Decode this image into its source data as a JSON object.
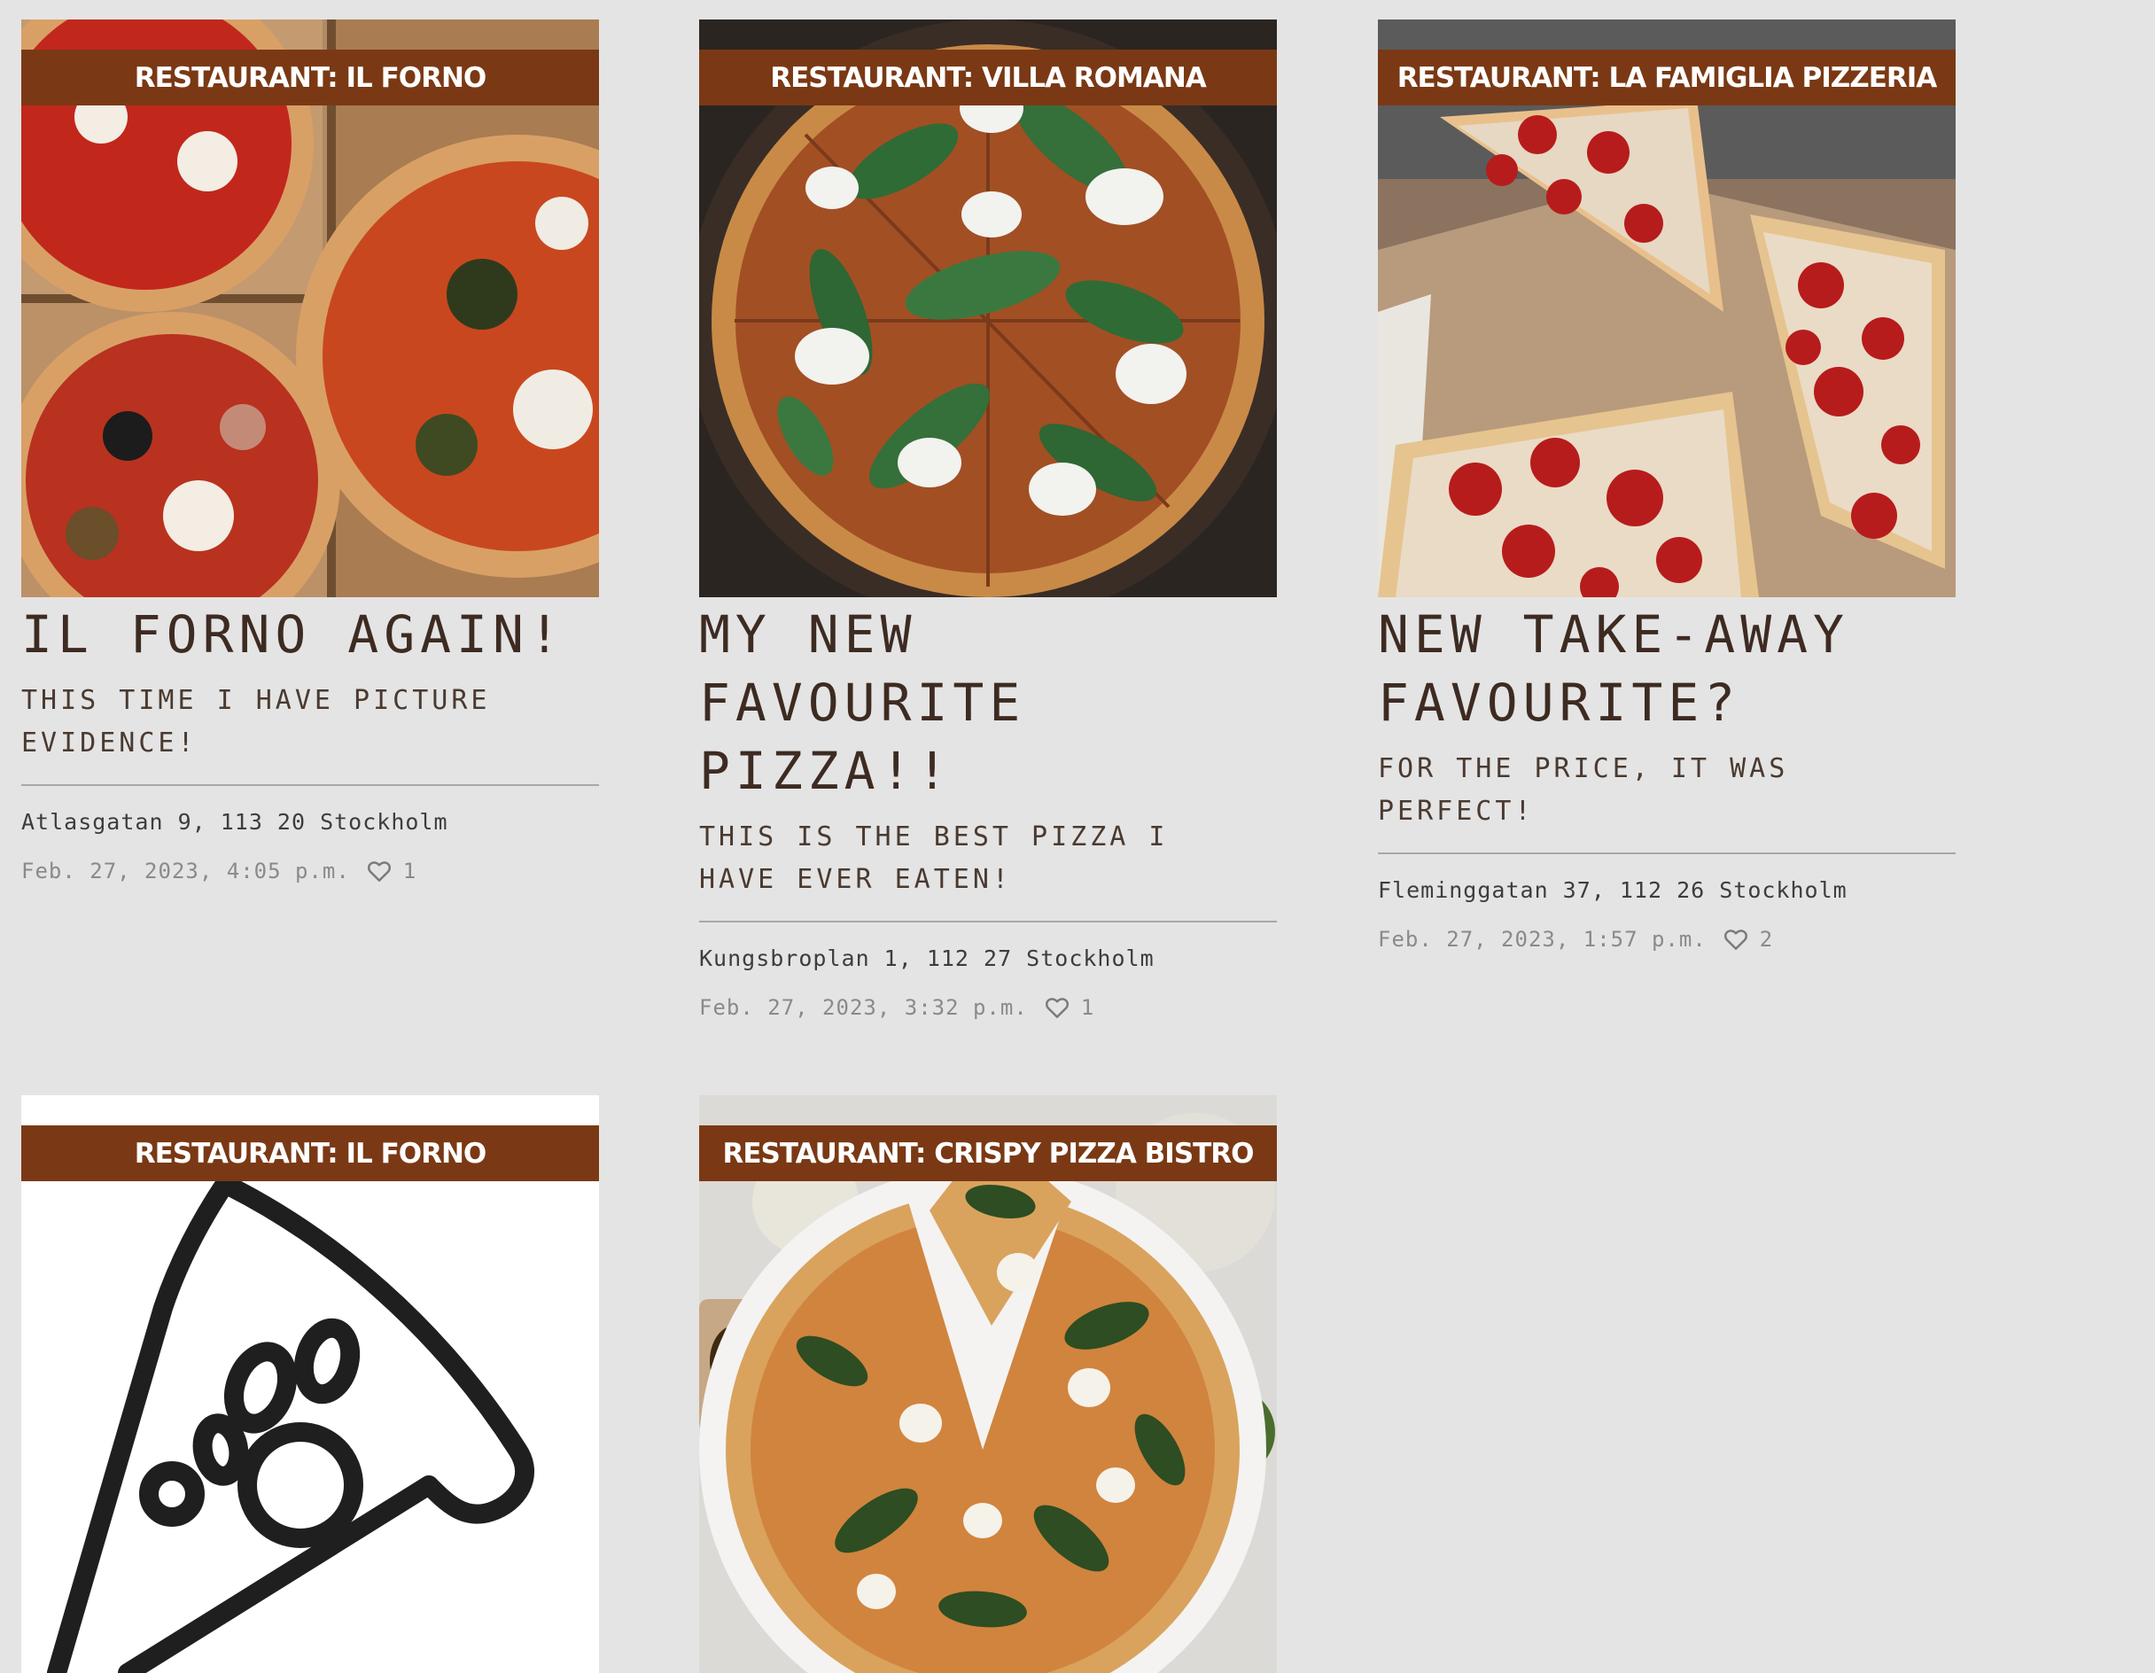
{
  "posts": [
    {
      "restaurant": "RESTAURANT: IL FORNO",
      "title": "IL FORNO AGAIN!",
      "subtitle": "THIS TIME I HAVE PICTURE EVIDENCE!",
      "address": "Atlasgatan 9, 113 20 Stockholm",
      "date": "Feb. 27, 2023, 4:05 p.m.",
      "likes": "1",
      "image": "pizza-boxes-photo"
    },
    {
      "restaurant": "RESTAURANT: VILLA ROMANA",
      "title": "MY NEW FAVOURITE PIZZA!!",
      "subtitle": "THIS IS THE BEST PIZZA I HAVE EVER EATEN!",
      "address": "Kungsbroplan 1, 112 27 Stockholm",
      "date": "Feb. 27, 2023, 3:32 p.m.",
      "likes": "1",
      "image": "arugula-pizza-photo"
    },
    {
      "restaurant": "RESTAURANT: LA FAMIGLIA PIZZERIA",
      "title": "NEW TAKE-AWAY FAVOURITE?",
      "subtitle": "FOR THE PRICE, IT WAS PERFECT!",
      "address": "Fleminggatan 37, 112 26 Stockholm",
      "date": "Feb. 27, 2023, 1:57 p.m.",
      "likes": "2",
      "image": "pepperoni-pizza-photo"
    },
    {
      "restaurant": "RESTAURANT: IL FORNO",
      "image": "pizza-slice-icon"
    },
    {
      "restaurant": "RESTAURANT: CRISPY PIZZA BISTRO",
      "image": "spinach-pizza-photo"
    }
  ],
  "colors": {
    "background": "#e4e4e4",
    "banner": "#7a3914",
    "banner_text": "#ffffff",
    "title_text": "#3d2b22",
    "meta_text": "#8a8a8a"
  }
}
